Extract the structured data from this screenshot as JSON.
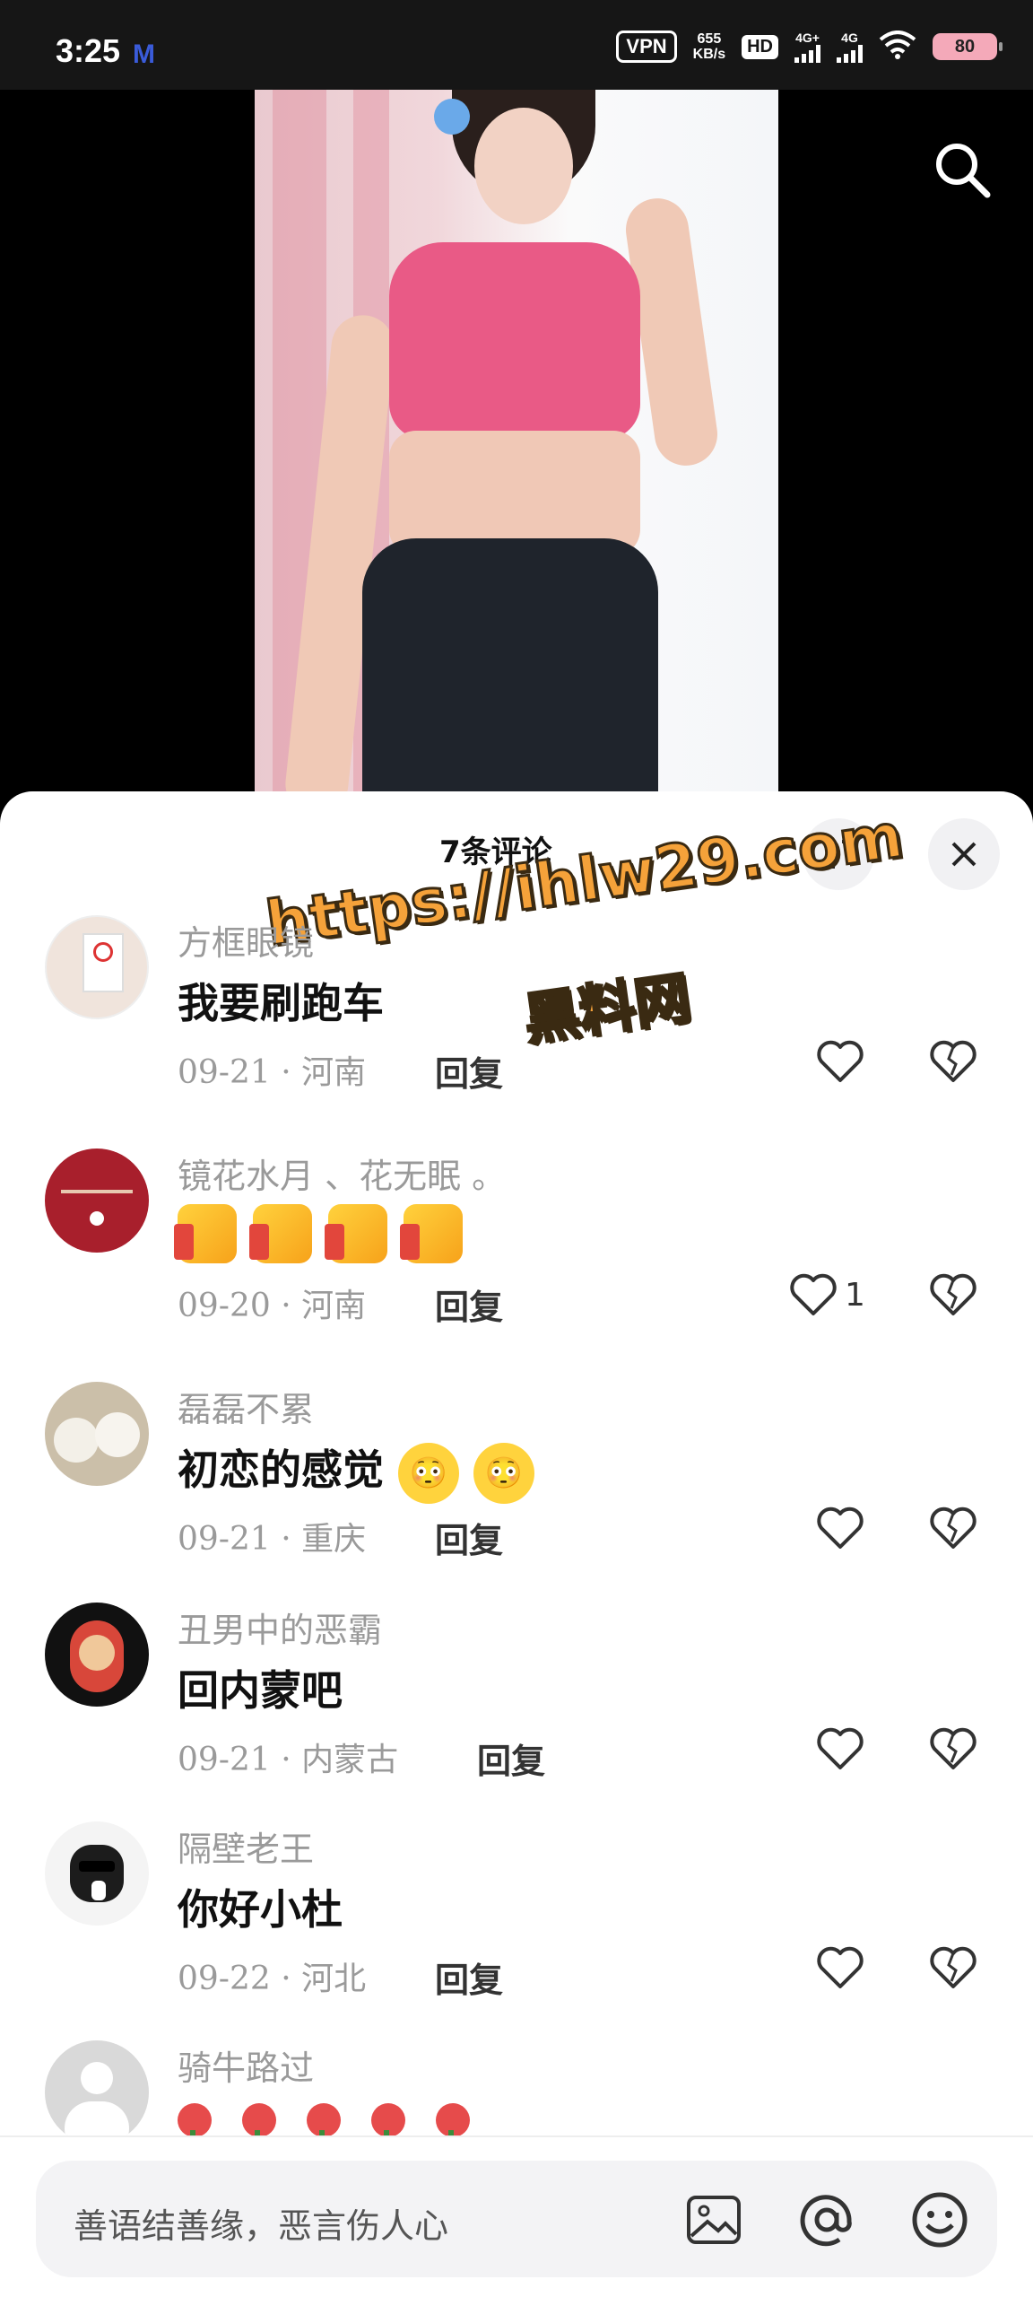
{
  "status_bar": {
    "time": "3:25",
    "carrier_logo": "M",
    "vpn": "VPN",
    "speed_value": "655",
    "speed_unit": "KB/s",
    "hd": "HD",
    "net1": "4G+",
    "net2": "4G",
    "battery": "80"
  },
  "video": {
    "search_icon": "search-icon"
  },
  "sheet": {
    "count": "7条评论",
    "watermark_url": "https://ihlw29.com",
    "watermark_name": "黑料网"
  },
  "comments": [
    {
      "user": "方框眼镜",
      "text": "我要刷跑车",
      "date": "09-21",
      "region": "河南",
      "reply": "回复",
      "likes": ""
    },
    {
      "user": "镜花水月 、花无眠 。",
      "text": "",
      "date": "09-20",
      "region": "河南",
      "reply": "回复",
      "likes": "1"
    },
    {
      "user": "磊磊不累",
      "text": "初恋的感觉",
      "date": "09-21",
      "region": "重庆",
      "reply": "回复",
      "likes": ""
    },
    {
      "user": "丑男中的恶霸",
      "text": "回内蒙吧",
      "date": "09-21",
      "region": "内蒙古",
      "reply": "回复",
      "likes": ""
    },
    {
      "user": "隔壁老王",
      "text": "你好小杜",
      "date": "09-22",
      "region": "河北",
      "reply": "回复",
      "likes": ""
    },
    {
      "user": "骑牛路过",
      "text": "",
      "date": "",
      "region": "",
      "reply": "",
      "likes": ""
    }
  ],
  "input": {
    "placeholder": "善语结善缘，恶言伤人心"
  },
  "colors": {
    "accent_pink": "#e95a86",
    "watermark_orange": "#f5a23a",
    "text_gray": "#9a9a9a"
  }
}
